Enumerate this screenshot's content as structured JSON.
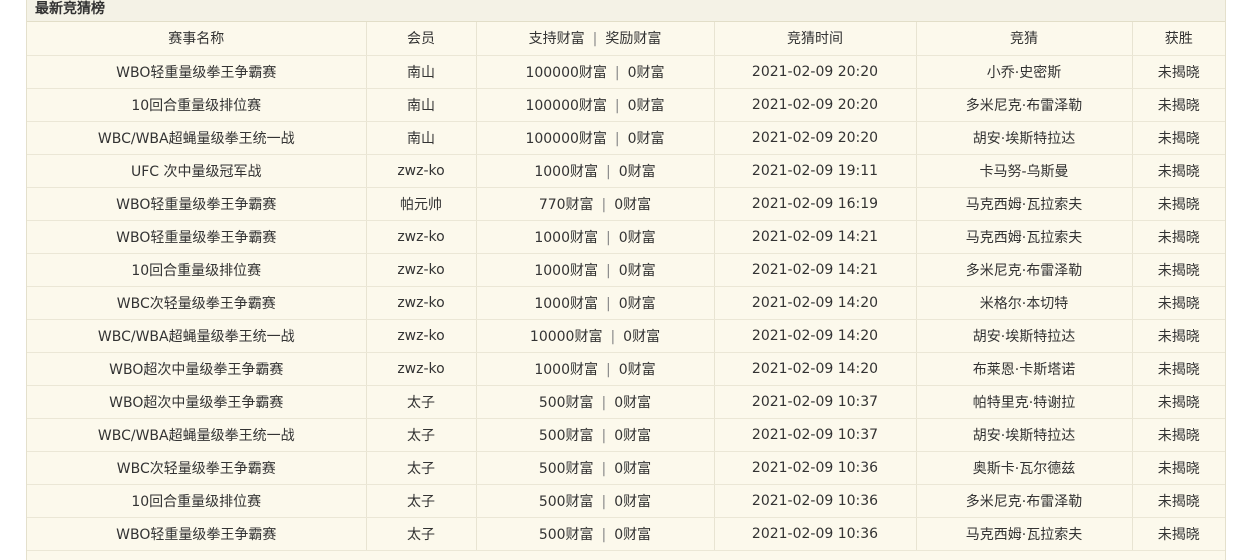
{
  "panel": {
    "title": "最新竞猜榜"
  },
  "columns": {
    "event": "赛事名称",
    "member": "会员",
    "support": "支持财富",
    "reward": "奖励财富",
    "time": "竞猜时间",
    "guess": "竞猜",
    "winner": "获胜"
  },
  "separator": "|",
  "rows": [
    {
      "event": "WBO轻重量级拳王争霸赛",
      "member": "南山",
      "support": "100000财富",
      "reward": "0财富",
      "time": "2021-02-09 20:20",
      "guess": "小乔·史密斯",
      "winner": "未揭晓"
    },
    {
      "event": "10回合重量级排位赛",
      "member": "南山",
      "support": "100000财富",
      "reward": "0财富",
      "time": "2021-02-09 20:20",
      "guess": "多米尼克·布雷泽勒",
      "winner": "未揭晓"
    },
    {
      "event": "WBC/WBA超蝇量级拳王统一战",
      "member": "南山",
      "support": "100000财富",
      "reward": "0财富",
      "time": "2021-02-09 20:20",
      "guess": "胡安·埃斯特拉达",
      "winner": "未揭晓"
    },
    {
      "event": "UFC 次中量级冠军战",
      "member": "zwz-ko",
      "support": "1000财富",
      "reward": "0财富",
      "time": "2021-02-09 19:11",
      "guess": "卡马努-乌斯曼",
      "winner": "未揭晓"
    },
    {
      "event": "WBO轻重量级拳王争霸赛",
      "member": "帕元帅",
      "support": "770财富",
      "reward": "0财富",
      "time": "2021-02-09 16:19",
      "guess": "马克西姆·瓦拉索夫",
      "winner": "未揭晓"
    },
    {
      "event": "WBO轻重量级拳王争霸赛",
      "member": "zwz-ko",
      "support": "1000财富",
      "reward": "0财富",
      "time": "2021-02-09 14:21",
      "guess": "马克西姆·瓦拉索夫",
      "winner": "未揭晓"
    },
    {
      "event": "10回合重量级排位赛",
      "member": "zwz-ko",
      "support": "1000财富",
      "reward": "0财富",
      "time": "2021-02-09 14:21",
      "guess": "多米尼克·布雷泽勒",
      "winner": "未揭晓"
    },
    {
      "event": "WBC次轻量级拳王争霸赛",
      "member": "zwz-ko",
      "support": "1000财富",
      "reward": "0财富",
      "time": "2021-02-09 14:20",
      "guess": "米格尔·本切特",
      "winner": "未揭晓"
    },
    {
      "event": "WBC/WBA超蝇量级拳王统一战",
      "member": "zwz-ko",
      "support": "10000财富",
      "reward": "0财富",
      "time": "2021-02-09 14:20",
      "guess": "胡安·埃斯特拉达",
      "winner": "未揭晓"
    },
    {
      "event": "WBO超次中量级拳王争霸赛",
      "member": "zwz-ko",
      "support": "1000财富",
      "reward": "0财富",
      "time": "2021-02-09 14:20",
      "guess": "布莱恩·卡斯塔诺",
      "winner": "未揭晓"
    },
    {
      "event": "WBO超次中量级拳王争霸赛",
      "member": "太子",
      "support": "500财富",
      "reward": "0财富",
      "time": "2021-02-09 10:37",
      "guess": "帕特里克·特谢拉",
      "winner": "未揭晓"
    },
    {
      "event": "WBC/WBA超蝇量级拳王统一战",
      "member": "太子",
      "support": "500财富",
      "reward": "0财富",
      "time": "2021-02-09 10:37",
      "guess": "胡安·埃斯特拉达",
      "winner": "未揭晓"
    },
    {
      "event": "WBC次轻量级拳王争霸赛",
      "member": "太子",
      "support": "500财富",
      "reward": "0财富",
      "time": "2021-02-09 10:36",
      "guess": "奥斯卡·瓦尔德兹",
      "winner": "未揭晓"
    },
    {
      "event": "10回合重量级排位赛",
      "member": "太子",
      "support": "500财富",
      "reward": "0财富",
      "time": "2021-02-09 10:36",
      "guess": "多米尼克·布雷泽勒",
      "winner": "未揭晓"
    },
    {
      "event": "WBO轻重量级拳王争霸赛",
      "member": "太子",
      "support": "500财富",
      "reward": "0财富",
      "time": "2021-02-09 10:36",
      "guess": "马克西姆·瓦拉索夫",
      "winner": "未揭晓"
    }
  ]
}
